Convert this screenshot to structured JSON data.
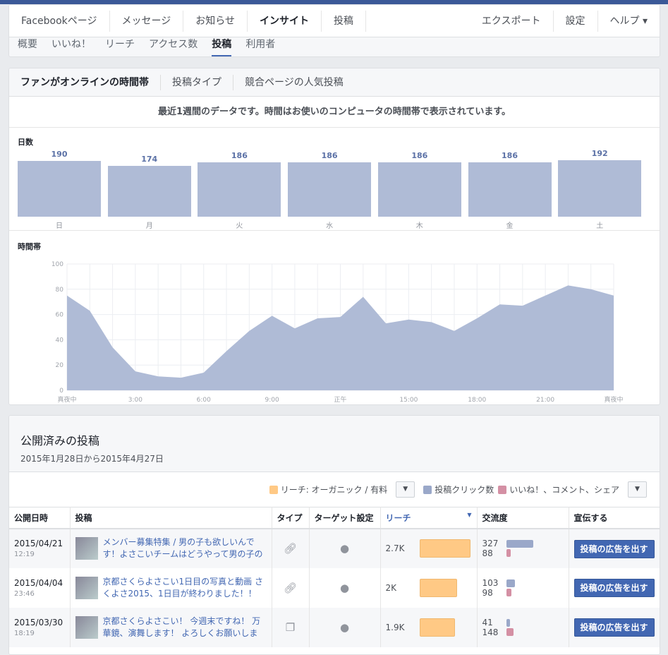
{
  "nav": {
    "items": [
      "Facebookページ",
      "メッセージ",
      "お知らせ",
      "インサイト",
      "投稿"
    ],
    "active": 3,
    "right": [
      "エクスポート",
      "設定",
      "ヘルプ ▾"
    ]
  },
  "subnav": {
    "items": [
      "概要",
      "いいね！",
      "リーチ",
      "アクセス数",
      "投稿",
      "利用者"
    ],
    "active": 4
  },
  "tabs": {
    "items": [
      "ファンがオンラインの時間帯",
      "投稿タイプ",
      "競合ページの人気投稿"
    ]
  },
  "notice": "最近1週間のデータです。時間はお使いのコンピュータの時間帯で表示されています。",
  "chart_data": [
    {
      "type": "bar",
      "title": "日数",
      "categories": [
        "日",
        "月",
        "火",
        "水",
        "木",
        "金",
        "土"
      ],
      "values": [
        190,
        174,
        186,
        186,
        186,
        186,
        192
      ]
    },
    {
      "type": "area",
      "title": "時間帯",
      "x": [
        0,
        1,
        2,
        3,
        4,
        5,
        6,
        7,
        8,
        9,
        10,
        11,
        12,
        13,
        14,
        15,
        16,
        17,
        18,
        19,
        20,
        21,
        22,
        23,
        24
      ],
      "values": [
        75,
        63,
        34,
        15,
        11,
        10,
        14,
        31,
        47,
        59,
        49,
        57,
        58,
        74,
        53,
        56,
        54,
        47,
        57,
        68,
        67,
        75,
        83,
        80,
        75
      ],
      "ylim": [
        0,
        100
      ],
      "yticks": [
        "0",
        "20",
        "40",
        "60",
        "80",
        "100"
      ],
      "xticks": [
        "真夜中",
        "3:00",
        "6:00",
        "9:00",
        "正午",
        "15:00",
        "18:00",
        "21:00",
        "真夜中"
      ],
      "color": "#afbbd6"
    }
  ],
  "published": {
    "title": "公開済みの投稿",
    "range": "2015年1月28日から2015年4月27日",
    "legend": [
      "リーチ: オーガニック / 有料",
      "投稿クリック数",
      "いいね！、コメント、シェア"
    ],
    "columns": [
      "公開日時",
      "投稿",
      "タイプ",
      "ターゲット設定",
      "リーチ",
      "交流度",
      "宣伝する"
    ],
    "rows": [
      {
        "date": "2015/04/21",
        "time": "12:19",
        "text": "メンバー募集特集 / 男の子も欲しいんです！よさこいチームはどうやって男の子の",
        "type": "link-icon",
        "reach": "2.7K",
        "reach_value": 2700,
        "clicks": "327",
        "reactions": "88",
        "button": "投稿の広告を出す"
      },
      {
        "date": "2015/04/04",
        "time": "23:46",
        "text": "京都さくらよさこい1日目の写真と動画 さくよさ2015、1日目が終わりました！！",
        "type": "link-icon",
        "reach": "2K",
        "reach_value": 2000,
        "clicks": "103",
        "reactions": "98",
        "button": "投稿の広告を出す"
      },
      {
        "date": "2015/03/30",
        "time": "18:19",
        "text": "京都さくらよさこい！ 今週末ですね！ 万華鏡、演舞します！ よろしくお願いしま",
        "type": "album-icon",
        "reach": "1.9K",
        "reach_value": 1900,
        "clicks": "41",
        "reactions": "148",
        "button": "投稿の広告を出す"
      }
    ]
  }
}
